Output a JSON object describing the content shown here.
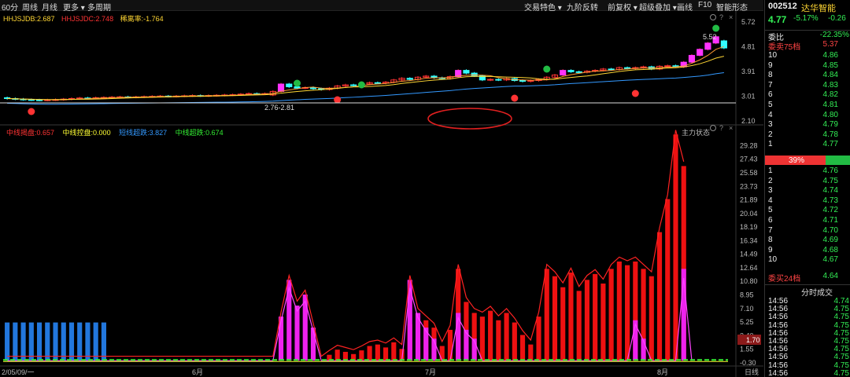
{
  "toolbar": {
    "left": [
      "60分",
      "周线",
      "月线",
      "更多 ▾",
      "多周期"
    ],
    "right": [
      "交易特色 ▾",
      "九阶反转",
      "前复权 ▾",
      "超级叠加 ▾",
      "画线",
      "F10",
      "智能形态"
    ]
  },
  "legend_top": [
    {
      "label": "HHJSJDB:2.687",
      "color": "#ffd633"
    },
    {
      "label": "HHJSJDC:2.748",
      "color": "#ff3333"
    },
    {
      "label": "稀离率:-1.764",
      "color": "#ffd633"
    }
  ],
  "legend_bottom": [
    {
      "label": "中线揭盘:0.657",
      "color": "#ff3333"
    },
    {
      "label": "中线控盘:0.000",
      "color": "#ffff33"
    },
    {
      "label": "短线超跌:3.827",
      "color": "#3399ff"
    },
    {
      "label": "中线超跌:0.674",
      "color": "#33ee33"
    }
  ],
  "panel_label": "主力状态",
  "annotations": {
    "low_range": "2.76-2.81",
    "high_price": "5.52"
  },
  "price_axis": [
    "5.72",
    "4.81",
    "3.91",
    "3.01",
    "2.10"
  ],
  "indicator_axis": [
    "29.28",
    "27.43",
    "25.58",
    "23.73",
    "21.89",
    "20.04",
    "18.19",
    "16.34",
    "14.49",
    "12.64",
    "10.80",
    "8.95",
    "7.10",
    "5.25",
    "3.40",
    "1.55",
    "-0.30"
  ],
  "current_value": "1.70",
  "x_labels": [
    "2/05/09/一",
    "6月",
    "7月",
    "8月"
  ],
  "period_label": "日线",
  "quote": {
    "code": "002512",
    "name": "达华智能",
    "price": "4.77",
    "change_pct": "-5.17%",
    "change": "-0.26",
    "weibi_label": "委比",
    "weibi": "-22.35%",
    "ask_header": "委卖75档",
    "ask_header_price": "5.37",
    "asks": [
      {
        "level": "10",
        "price": "4.86"
      },
      {
        "level": "9",
        "price": "4.85"
      },
      {
        "level": "8",
        "price": "4.84"
      },
      {
        "level": "7",
        "price": "4.83"
      },
      {
        "level": "6",
        "price": "4.82"
      },
      {
        "level": "5",
        "price": "4.81"
      },
      {
        "level": "4",
        "price": "4.80"
      },
      {
        "level": "3",
        "price": "4.79"
      },
      {
        "level": "2",
        "price": "4.78"
      },
      {
        "level": "1",
        "price": "4.77"
      }
    ],
    "ratio": "39%",
    "bids": [
      {
        "level": "1",
        "price": "4.76"
      },
      {
        "level": "2",
        "price": "4.75"
      },
      {
        "level": "3",
        "price": "4.74"
      },
      {
        "level": "4",
        "price": "4.73"
      },
      {
        "level": "5",
        "price": "4.72"
      },
      {
        "level": "6",
        "price": "4.71"
      },
      {
        "level": "7",
        "price": "4.70"
      },
      {
        "level": "8",
        "price": "4.69"
      },
      {
        "level": "9",
        "price": "4.68"
      },
      {
        "level": "10",
        "price": "4.67"
      }
    ],
    "bid_header": "委买24档",
    "bid_header_price": "4.64",
    "ticks_title": "分时成交",
    "ticks": [
      {
        "time": "14:56",
        "price": "4.74"
      },
      {
        "time": "14:56",
        "price": "4.75"
      },
      {
        "time": "14:56",
        "price": "4.75"
      },
      {
        "time": "14:56",
        "price": "4.75"
      },
      {
        "time": "14:56",
        "price": "4.75"
      },
      {
        "time": "14:56",
        "price": "4.75"
      },
      {
        "time": "14:56",
        "price": "4.75"
      },
      {
        "time": "14:56",
        "price": "4.75"
      },
      {
        "time": "14:56",
        "price": "4.75"
      },
      {
        "time": "14:56",
        "price": "4.75"
      }
    ]
  },
  "chart_data": [
    {
      "type": "candlestick",
      "title": "",
      "ylim": [
        2.1,
        5.72
      ],
      "note": "daily K-line with moving averages",
      "closes": [
        2.92,
        2.9,
        2.88,
        2.87,
        2.86,
        2.87,
        2.88,
        2.9,
        2.92,
        2.94,
        2.93,
        2.95,
        2.96,
        2.97,
        2.98,
        2.97,
        2.98,
        2.99,
        3.0,
        3.01,
        3.0,
        3.01,
        3.02,
        3.03,
        3.02,
        3.03,
        3.04,
        3.05,
        3.06,
        3.08,
        3.1,
        3.09,
        3.1,
        3.18,
        3.45,
        3.35,
        3.3,
        3.32,
        3.28,
        3.25,
        3.3,
        3.38,
        3.42,
        3.4,
        3.45,
        3.5,
        3.48,
        3.52,
        3.6,
        3.66,
        3.62,
        3.7,
        3.74,
        3.68,
        3.65,
        3.72,
        3.95,
        3.85,
        3.75,
        3.6,
        3.62,
        3.6,
        3.65,
        3.58,
        3.55,
        3.58,
        3.62,
        3.7,
        3.78,
        3.95,
        3.9,
        3.88,
        3.92,
        3.95,
        4.0,
        3.98,
        4.05,
        4.02,
        4.05,
        4.08,
        4.0,
        4.1,
        4.12,
        4.08,
        4.25,
        4.5,
        4.72,
        4.95,
        5.18,
        4.77
      ],
      "opens": [
        2.95,
        2.92,
        2.9,
        2.88,
        2.87,
        2.86,
        2.87,
        2.88,
        2.9,
        2.92,
        2.94,
        2.93,
        2.95,
        2.96,
        2.97,
        2.98,
        2.97,
        2.98,
        2.99,
        3.0,
        3.01,
        3.0,
        3.01,
        3.02,
        3.03,
        3.02,
        3.03,
        3.04,
        3.05,
        3.06,
        3.08,
        3.1,
        3.09,
        3.05,
        3.18,
        3.45,
        3.35,
        3.3,
        3.32,
        3.28,
        3.25,
        3.3,
        3.38,
        3.42,
        3.4,
        3.45,
        3.5,
        3.48,
        3.52,
        3.6,
        3.66,
        3.62,
        3.7,
        3.74,
        3.68,
        3.65,
        3.72,
        3.95,
        3.85,
        3.75,
        3.6,
        3.62,
        3.6,
        3.65,
        3.58,
        3.55,
        3.58,
        3.62,
        3.7,
        3.78,
        3.95,
        3.9,
        3.88,
        3.92,
        3.95,
        4.0,
        3.98,
        4.05,
        4.02,
        4.05,
        4.08,
        4.0,
        4.1,
        4.12,
        4.08,
        4.25,
        4.5,
        4.72,
        4.95,
        5.03
      ]
    },
    {
      "type": "bar",
      "title": "",
      "ylim": [
        -0.3,
        30.5
      ],
      "red_values": [
        0,
        0,
        0,
        0,
        0,
        0,
        0,
        0,
        0,
        0,
        0,
        0,
        0,
        0,
        0,
        0,
        0,
        0,
        0,
        0,
        0,
        0,
        0,
        0,
        0,
        0,
        0,
        0,
        0,
        0,
        0,
        0,
        0,
        0,
        0,
        0,
        0,
        0,
        0,
        0,
        0.8,
        1.5,
        1.2,
        0.9,
        1.4,
        2.0,
        2.2,
        1.8,
        2.5,
        1.6,
        5.0,
        3.0,
        5.5,
        4.5,
        2.0,
        4.2,
        12.5,
        8.0,
        6.5,
        6.0,
        6.8,
        5.5,
        6.5,
        5.2,
        3.5,
        2.2,
        6.0,
        12.5,
        11.5,
        10.0,
        12.0,
        9.5,
        11.0,
        11.8,
        10.5,
        12.5,
        13.5,
        13.0,
        13.5,
        12.5,
        11.5,
        17.5,
        22.0,
        30.8,
        26.5
      ],
      "magenta_values": [
        0,
        0,
        0,
        0,
        0,
        0,
        0,
        0,
        0,
        0,
        0,
        0,
        0,
        0,
        0,
        0,
        0,
        0,
        0,
        0,
        0,
        0,
        0,
        0,
        0,
        0,
        0,
        0,
        0,
        0,
        0,
        0,
        0,
        0,
        6.0,
        11.0,
        7.5,
        9.0,
        4.5,
        0,
        0,
        0,
        0,
        0,
        0,
        0,
        0,
        0,
        0,
        0,
        11.0,
        6.5,
        4.5,
        3.0,
        0,
        0,
        6.5,
        4.2,
        3.0,
        0,
        0,
        0,
        0,
        0,
        0,
        0,
        0,
        0,
        0,
        0,
        0,
        0,
        0,
        0,
        0,
        0,
        0,
        0,
        5.5,
        3.0,
        0,
        0,
        0,
        0,
        12.5,
        0
      ],
      "blue_values": [
        5.2,
        5.2,
        5.2,
        5.2,
        5.2,
        5.2,
        5.2,
        5.2,
        5.2,
        5.2,
        5.2,
        5.2,
        5.2,
        0,
        0,
        0,
        0,
        0,
        0,
        0,
        0,
        0,
        0,
        0,
        0,
        0,
        0,
        0,
        0,
        0,
        0,
        0,
        0,
        0,
        0,
        0,
        0,
        0,
        0,
        0,
        0,
        0,
        0,
        0,
        0,
        0,
        0,
        0,
        0,
        0,
        0,
        0,
        0,
        0,
        0,
        0,
        0,
        0,
        0,
        0,
        0,
        0,
        0,
        0,
        0,
        0,
        0,
        0,
        0,
        0,
        0,
        0,
        0,
        0,
        0,
        0,
        0,
        0,
        0,
        0,
        0,
        0,
        0,
        0,
        0,
        0,
        0,
        0,
        0,
        0
      ]
    }
  ]
}
